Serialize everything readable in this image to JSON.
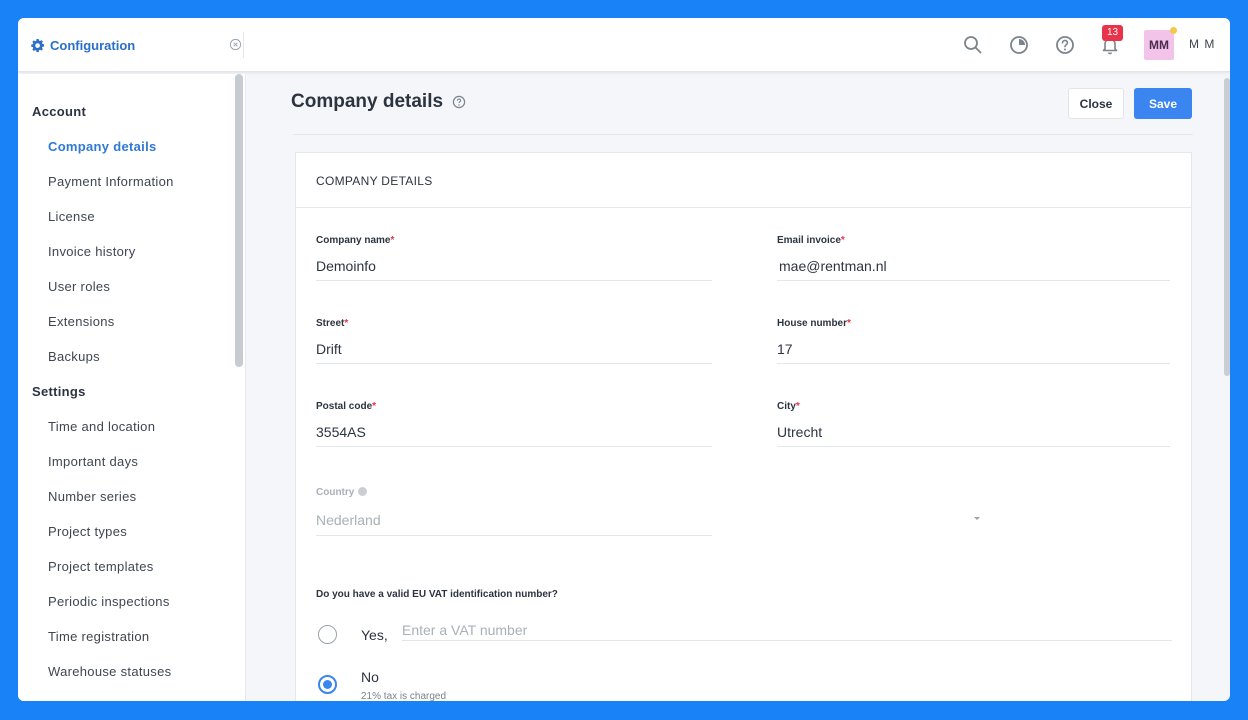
{
  "app": {
    "tab_label": "Configuration",
    "notification_count": "13",
    "avatar_initials": "MM",
    "user_name": "M M",
    "accent_color": "#3a85f0",
    "badge_color": "#e8334a"
  },
  "sidebar": {
    "sections": [
      {
        "heading": "Account",
        "items": [
          "Company details",
          "Payment Information",
          "License",
          "Invoice history",
          "User roles",
          "Extensions",
          "Backups"
        ]
      },
      {
        "heading": "Settings",
        "items": [
          "Time and location",
          "Important days",
          "Number series",
          "Project types",
          "Project templates",
          "Periodic inspections",
          "Time registration",
          "Warehouse statuses"
        ]
      }
    ],
    "active_item": "Company details"
  },
  "page": {
    "title": "Company details",
    "close_label": "Close",
    "save_label": "Save"
  },
  "form": {
    "section_title": "COMPANY DETAILS",
    "required_mark": "*",
    "fields": {
      "company_name": {
        "label": "Company name",
        "value": "Demoinfo"
      },
      "email_invoice": {
        "label": "Email invoice",
        "value": "mae@rentman.nl"
      },
      "street": {
        "label": "Street",
        "value": "Drift"
      },
      "house_number": {
        "label": "House number",
        "value": "17"
      },
      "postal_code": {
        "label": "Postal code",
        "value": "3554AS"
      },
      "city": {
        "label": "City",
        "value": "Utrecht"
      },
      "country": {
        "label": "Country",
        "value": "Nederland"
      }
    },
    "vat": {
      "question": "Do you have a valid EU VAT identification number?",
      "yes_label": "Yes,",
      "vat_placeholder": "Enter a VAT number",
      "no_label": "No",
      "no_sublabel": "21% tax is charged",
      "selected": "No"
    }
  }
}
